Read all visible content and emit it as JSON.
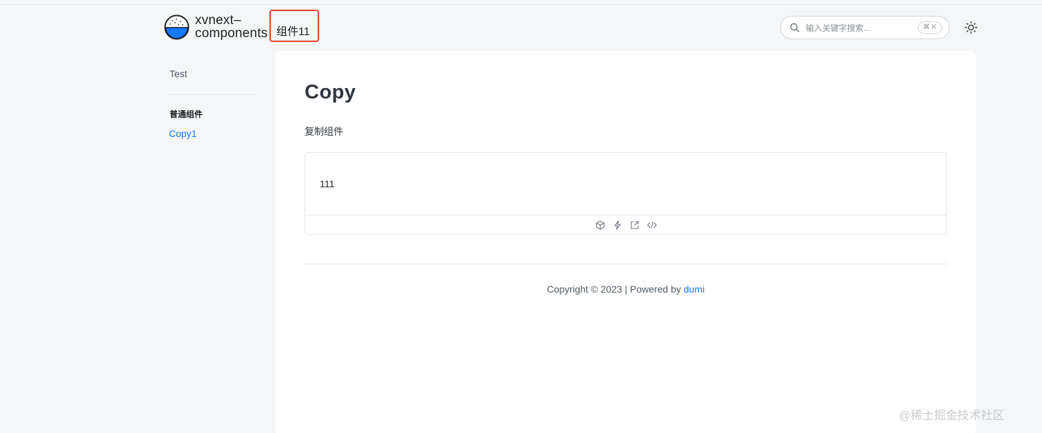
{
  "header": {
    "logo_icon": "rice-bowl-logo-icon",
    "site_title_line1": "xvnext–",
    "site_title_line2": "components",
    "nav_item": "组件11",
    "search": {
      "placeholder": "输入关键字搜索...",
      "shortcut": "⌘ K",
      "icon": "search-icon"
    },
    "theme_icon": "sun-icon"
  },
  "sidebar": {
    "top_item": "Test",
    "group_title": "普通组件",
    "items": [
      {
        "label": "Copy1",
        "active": true
      }
    ]
  },
  "main": {
    "title": "Copy",
    "description": "复制组件",
    "demo": {
      "preview_text": "111",
      "actions": [
        "codesandbox-icon",
        "stackblitz-icon",
        "open-external-icon",
        "show-code-icon"
      ]
    },
    "footer": {
      "copyright": "Copyright © 2023 | Powered by ",
      "powered_by_link": "dumi"
    }
  },
  "watermark": "@稀土掘金技术社区",
  "colors": {
    "accent": "#1677ff",
    "highlight_border": "#e8402b",
    "page_bg": "#f5f6f8"
  }
}
